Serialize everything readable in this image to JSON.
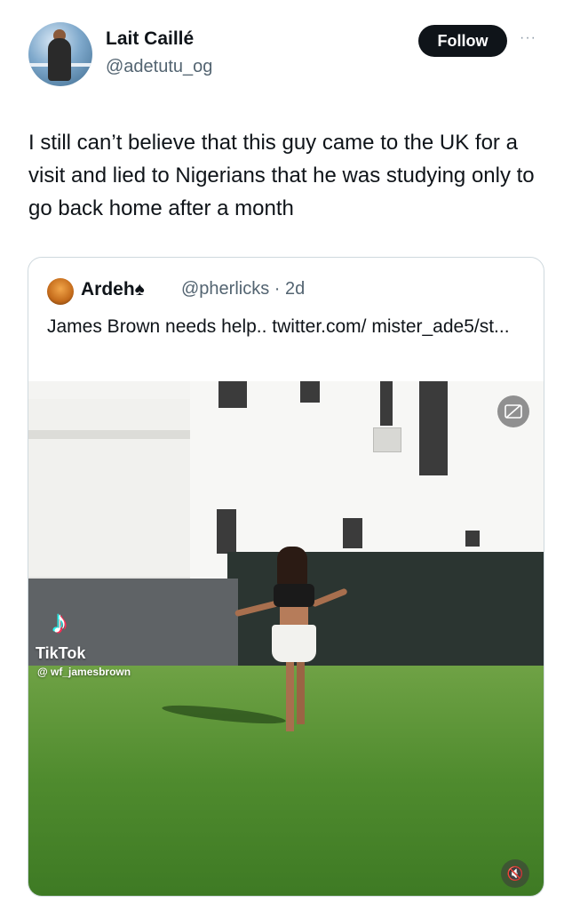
{
  "author": {
    "display_name": "Lait Caillé",
    "handle": "@adetutu_og",
    "avatar_icon": "user-photo"
  },
  "follow_label": "Follow",
  "more_icon": "···",
  "tweet_text": "I still can’t believe that this guy came to the UK for a visit and lied to Nigerians that he was studying only to go back home after a month",
  "quoted": {
    "display_name": "Ardeh♠",
    "handle_time": "@pherlicks · 2d",
    "text": "James Brown needs help.. twitter.com/ mister_ade5/st...",
    "video": {
      "watermark_brand": "TikTok",
      "watermark_user": "@ wf_jamesbrown",
      "captions_icon": "cc",
      "mute_icon": "🔇"
    }
  },
  "colors": {
    "text_primary": "#0f1419",
    "text_secondary": "#536471",
    "follow_bg": "#0f1419",
    "border": "#cfd9de"
  }
}
